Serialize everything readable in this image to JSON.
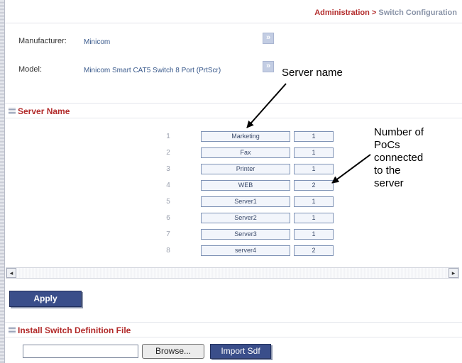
{
  "breadcrumb": {
    "section": "Administration",
    "separator": ">",
    "current": "Switch Configuration"
  },
  "info": {
    "manufacturer_label": "Manufacturer:",
    "manufacturer_value": "Minicom",
    "model_label": "Model:",
    "model_value": "Minicom Smart CAT5 Switch 8 Port (PrtScr)",
    "expand_glyph": "»"
  },
  "server_section": {
    "title": "Server Name"
  },
  "servers": [
    {
      "num": "1",
      "name": "Marketing",
      "pocs": "1"
    },
    {
      "num": "2",
      "name": "Fax",
      "pocs": "1"
    },
    {
      "num": "3",
      "name": "Printer",
      "pocs": "1"
    },
    {
      "num": "4",
      "name": "WEB",
      "pocs": "2"
    },
    {
      "num": "5",
      "name": "Server1",
      "pocs": "1"
    },
    {
      "num": "6",
      "name": "Server2",
      "pocs": "1"
    },
    {
      "num": "7",
      "name": "Server3",
      "pocs": "1"
    },
    {
      "num": "8",
      "name": "server4",
      "pocs": "2"
    }
  ],
  "scroll": {
    "left_glyph": "◂",
    "right_glyph": "▸"
  },
  "apply_label": "Apply",
  "install_section": {
    "title": "Install Switch Definition File"
  },
  "file_input": {
    "value": ""
  },
  "browse_label": "Browse...",
  "import_label": "Import Sdf",
  "annotations": {
    "server_name": "Server name",
    "pocs_lines": [
      "Number of",
      "PoCs",
      "connected",
      "to the",
      "server"
    ]
  }
}
